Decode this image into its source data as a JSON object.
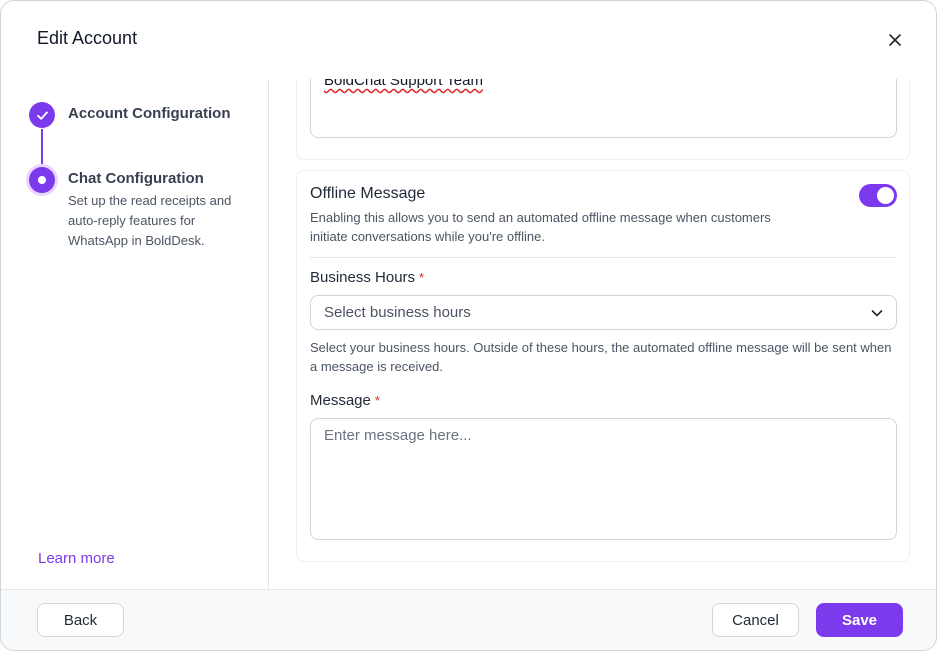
{
  "dialog": {
    "title": "Edit Account",
    "close_icon": "close-icon"
  },
  "stepper": {
    "steps": [
      {
        "title": "Account Configuration",
        "state": "completed",
        "icon": "check-icon"
      },
      {
        "title": "Chat Configuration",
        "state": "active",
        "description": "Set up the read receipts and auto-reply features for WhatsApp in BoldDesk."
      }
    ],
    "learn_more": "Learn more"
  },
  "form": {
    "name_value": "BoldChat Support Team",
    "offline_message": {
      "title": "Offline Message",
      "description": "Enabling this allows you to send an automated offline message when customers initiate conversations while you're offline.",
      "enabled": true
    },
    "business_hours": {
      "label": "Business Hours",
      "required_mark": "*",
      "placeholder": "Select business hours",
      "help": "Select your business hours. Outside of these hours, the automated offline message will be sent when a message is received."
    },
    "message": {
      "label": "Message",
      "required_mark": "*",
      "placeholder": "Enter message here..."
    }
  },
  "footer": {
    "back_label": "Back",
    "cancel_label": "Cancel",
    "save_label": "Save"
  },
  "colors": {
    "accent": "#7c3aed",
    "required": "#dc2626",
    "footer_bg": "#f8f9fb"
  }
}
